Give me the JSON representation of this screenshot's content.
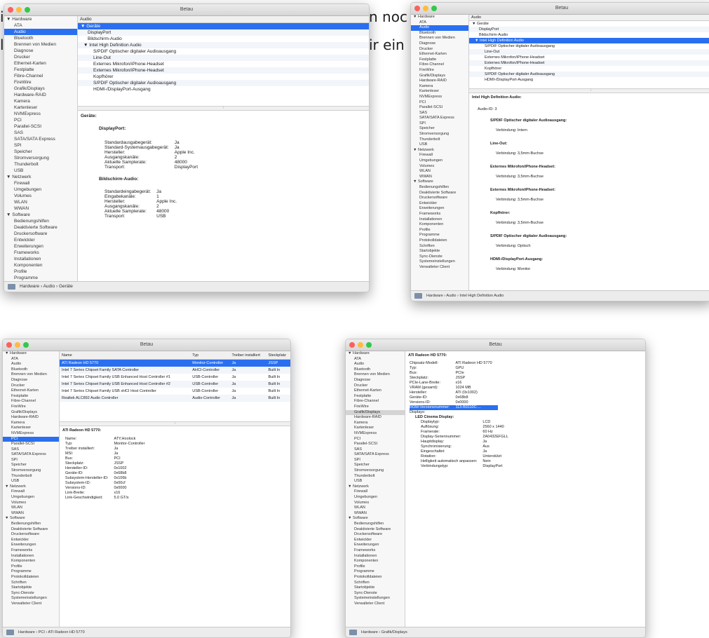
{
  "bg_text": {
    "line1_left": "i",
    "line1_right": "n noc",
    "line2_left": "l",
    "line2_right": "ir ein"
  },
  "window_title": "Betau",
  "sidebar_items": [
    "▼ Hardware",
    "ATA",
    "Audio",
    "Bluetooth",
    "Brennen von Medien",
    "Diagnose",
    "Drucker",
    "Ethernet-Karten",
    "Festplatte",
    "Fibre-Channel",
    "FireWire",
    "Grafik/Displays",
    "Hardware-RAID",
    "Kamera",
    "Kartenleser",
    "NVMExpress",
    "PCI",
    "Parallel-SCSI",
    "SAS",
    "SATA/SATA Express",
    "SPI",
    "Speicher",
    "Stromversorgung",
    "Thunderbolt",
    "USB",
    "▼ Netzwerk",
    "Firewall",
    "Umgebungen",
    "Volumes",
    "WLAN",
    "WWAN",
    "▼ Software",
    "Bedienungshilfen",
    "Deaktivierte Software",
    "Druckersoftware",
    "Entwickler",
    "Erweiterungen",
    "Frameworks",
    "Installationen",
    "Komponenten",
    "Profile",
    "Programme",
    "Protokolldateien",
    "Schriften",
    "Startobjekte",
    "Sync-Dienste",
    "Systemeinstellungen",
    "Verwalteter Client"
  ],
  "w1": {
    "header": "Audio",
    "tree": [
      "▼ Geräte",
      "DisplayPort",
      "Bildschirm-Audio",
      "▼ Intel High Definition Audio",
      "S/PDIF Optischer digitaler Audioausgang",
      "Line-Out",
      "Externes Mikrofon/iPhone-Headset",
      "Externes Mikrofon/iPhone-Headset",
      "Kopfhörer",
      "S/PDIF Optischer digitaler Audioausgang",
      "HDMI-/DisplayPort-Ausgang"
    ],
    "detail_title": "Geräte:",
    "sec1_title": "DisplayPort:",
    "sec1_rows": [
      [
        "Standardausgabegerät:",
        "Ja"
      ],
      [
        "Standard-Systemausgabegerät:",
        "Ja"
      ],
      [
        "Hersteller:",
        "Apple Inc."
      ],
      [
        "Ausgangskanäle:",
        "2"
      ],
      [
        "Aktuelle Samplerate:",
        "48000"
      ],
      [
        "Transport:",
        "DisplayPort"
      ]
    ],
    "sec2_title": "Bildschirm-Audio:",
    "sec2_rows": [
      [
        "Standardeingabegerät:",
        "Ja"
      ],
      [
        "Eingabekanäle:",
        "1"
      ],
      [
        "Hersteller:",
        "Apple Inc."
      ],
      [
        "Ausgangskanäle:",
        "2"
      ],
      [
        "Aktuelle Samplerate:",
        "48000"
      ],
      [
        "Transport:",
        "USB"
      ]
    ],
    "status": "Hardware › Audio › Geräte"
  },
  "w2": {
    "header": "Audio",
    "tree": [
      "▼ Geräte",
      "DisplayPort",
      "Bildschirm-Audio",
      "▼ Intel High Definition Audio",
      "S/PDIF Optischer digitaler Audioausgang",
      "Line-Out",
      "Externes Mikrofon/iPhone-Headset",
      "Externes Mikrofon/iPhone-Headset",
      "Kopfhörer",
      "S/PDIF Optischer digitaler Audioausgang",
      "HDMI-/DisplayPort-Ausgang"
    ],
    "detail_title": "Intel High Definition Audio:",
    "audio_id": "Audio-ID:  3",
    "sections": [
      [
        "S/PDIF Optischer digitaler Audioausgang:",
        "Verbindung:  Intern"
      ],
      [
        "Line-Out:",
        "Verbindung:  3,5mm-Buchse"
      ],
      [
        "Externes Mikrofon/iPhone-Headset:",
        "Verbindung:  3,5mm-Buchse"
      ],
      [
        "Externes Mikrofon/iPhone-Headset:",
        "Verbindung:  3,5mm-Buchse"
      ],
      [
        "Kopfhörer:",
        "Verbindung:  3,5mm-Buchse"
      ],
      [
        "S/PDIF Optischer digitaler Audioausgang:",
        "Verbindung:  Optisch"
      ],
      [
        "HDMI-/DisplayPort-Ausgang:",
        "Verbindung:  Monitor"
      ]
    ],
    "status": "Hardware › Audio › Intel High Definition Audio"
  },
  "w3": {
    "columns": [
      "Name",
      "Typ",
      "Treiber installiert",
      "Steckplatz"
    ],
    "rows": [
      [
        "ATI Radeon HD 5770",
        "Monitor-Controller",
        "Ja",
        "JSSP"
      ],
      [
        "Intel 7 Series Chipset Family SATA Controller",
        "AHCI-Controller",
        "Ja",
        "Built In"
      ],
      [
        "Intel 7 Series Chipset Family USB Enhanced Host Controller #1",
        "USB-Controller",
        "Ja",
        "Built In"
      ],
      [
        "Intel 7 Series Chipset Family USB Enhanced Host Controller #2",
        "USB-Controller",
        "Ja",
        "Built In"
      ],
      [
        "Intel 7 Series Chipset Family USB xHCI Host Controller",
        "USB-Controller",
        "Ja",
        "Built In"
      ],
      [
        "Realtek ALC892 Audio Controller",
        "Audio-Controller",
        "Ja",
        "Built In"
      ]
    ],
    "detail_title": "ATI Radeon HD 5770:",
    "kv": [
      [
        "Name:",
        "ATY,Hoolock"
      ],
      [
        "Typ:",
        "Monitor-Controller"
      ],
      [
        "Treiber installiert:",
        "Ja"
      ],
      [
        "MSI:",
        "Ja"
      ],
      [
        "Bus:",
        "PCI"
      ],
      [
        "Steckplatz:",
        "JSSP"
      ],
      [
        "Hersteller-ID:",
        "0x1002"
      ],
      [
        "Geräte-ID:",
        "0x68b8"
      ],
      [
        "Subsystem-Hersteller-ID:",
        "0x106b"
      ],
      [
        "Subsystem-ID:",
        "0x00cf"
      ],
      [
        "Versions-ID:",
        "0x0000"
      ],
      [
        "Link-Breite:",
        "x16"
      ],
      [
        "Link-Geschwindigkeit:",
        "5.0 GT/s"
      ]
    ],
    "status": "Hardware › PCI › ATI Radeon HD 5770"
  },
  "w4": {
    "detail_title": "ATI Radeon HD 5770:",
    "kv": [
      [
        "Chipsatz-Modell:",
        "ATI Radeon HD 5770"
      ],
      [
        "Typ:",
        "GPU"
      ],
      [
        "Bus:",
        "PCIe"
      ],
      [
        "Steckplatz:",
        "JSSP"
      ],
      [
        "PCIe-Lane-Breite:",
        "x16"
      ],
      [
        "VRAM (gesamt):",
        "1024 MB"
      ],
      [
        "Hersteller:",
        "ATI (0x1002)"
      ],
      [
        "Geräte-ID:",
        "0x68b8"
      ],
      [
        "Versions-ID:",
        "0x0000"
      ],
      [
        "ROM-Versionsnummer:",
        "113-B9110C-..."
      ]
    ],
    "displays_label": "Displays:",
    "display_name": "LED Cinema Display:",
    "display_kv": [
      [
        "Displaytyp:",
        "LCD"
      ],
      [
        "Auflösung:",
        "2560 x 1440"
      ],
      [
        "Framerate:",
        "60 Hz"
      ],
      [
        "Display-Seriennummer:",
        "2A0432EFGLL"
      ],
      [
        "Hauptdisplay:",
        "Ja"
      ],
      [
        "Synchronisierung:",
        "Aus"
      ],
      [
        "Eingeschaltet:",
        "Ja"
      ],
      [
        "Rotation:",
        "Unterstützt"
      ],
      [
        "Helligkeit automatisch anpassen:",
        "Nein"
      ],
      [
        "Verbindungstyp:",
        "DisplayPort"
      ]
    ],
    "status": "Hardware › Grafik/Displays"
  }
}
